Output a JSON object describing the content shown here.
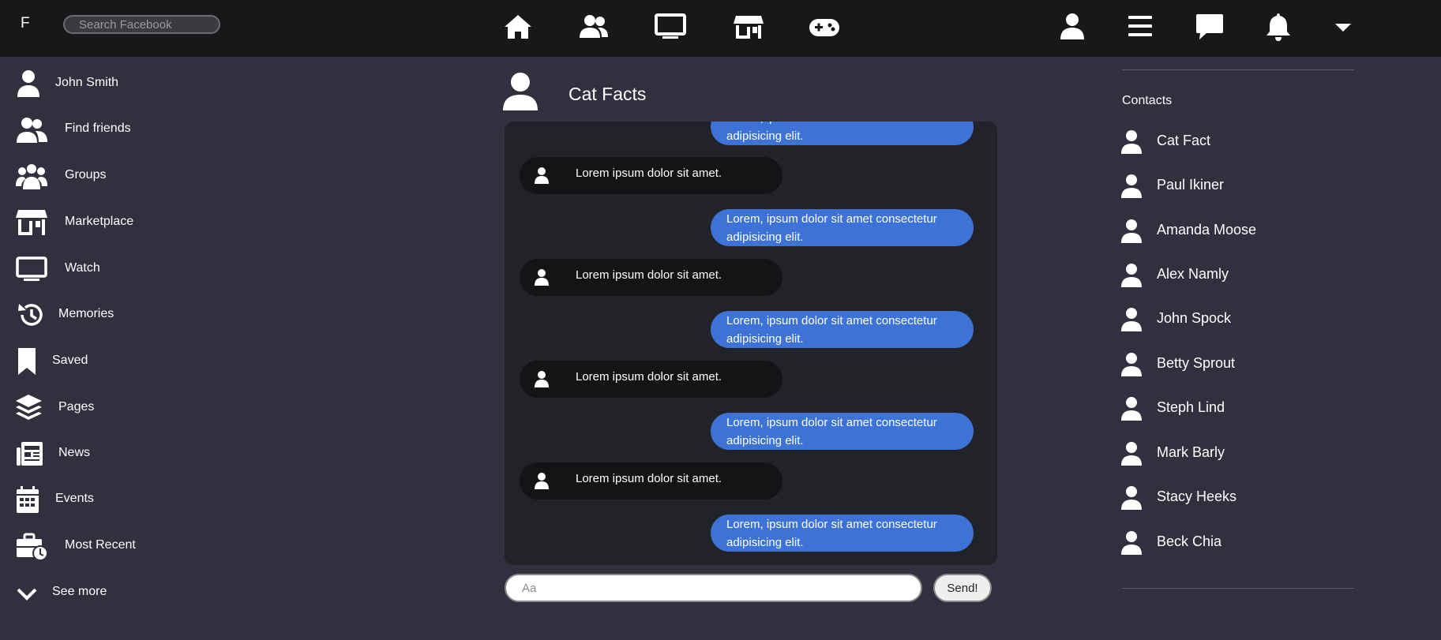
{
  "topbar": {
    "logo": "F",
    "search_placeholder": "Search Facebook",
    "nav_icons": [
      "home-icon",
      "friends-icon",
      "watch-icon",
      "marketplace-icon",
      "gaming-icon"
    ],
    "right_icons": [
      "profile-icon",
      "menu-icon",
      "messenger-icon",
      "bell-icon",
      "caret-down-icon"
    ]
  },
  "sidebar": {
    "items": [
      {
        "label": "John Smith",
        "icon": "user-icon"
      },
      {
        "label": "Find friends",
        "icon": "friends-icon"
      },
      {
        "label": "Groups",
        "icon": "groups-icon"
      },
      {
        "label": "Marketplace",
        "icon": "marketplace-icon"
      },
      {
        "label": "Watch",
        "icon": "watch-icon"
      },
      {
        "label": "Memories",
        "icon": "history-icon"
      },
      {
        "label": "Saved",
        "icon": "bookmark-icon"
      },
      {
        "label": "Pages",
        "icon": "layers-icon"
      },
      {
        "label": "News",
        "icon": "newspaper-icon"
      },
      {
        "label": "Events",
        "icon": "calendar-icon"
      },
      {
        "label": "Most Recent",
        "icon": "briefcase-clock-icon"
      },
      {
        "label": "See more",
        "icon": "chevron-down-icon"
      }
    ]
  },
  "chat": {
    "title": "Cat Facts",
    "messages": [
      {
        "type": "out",
        "text": "Lorem, ipsum dolor sit amet consectetur adipisicing elit."
      },
      {
        "type": "in",
        "text": "Lorem ipsum dolor sit amet."
      },
      {
        "type": "out",
        "text": "Lorem, ipsum dolor sit amet consectetur adipisicing elit."
      },
      {
        "type": "in",
        "text": "Lorem ipsum dolor sit amet."
      },
      {
        "type": "out",
        "text": "Lorem, ipsum dolor sit amet consectetur adipisicing elit."
      },
      {
        "type": "in",
        "text": "Lorem ipsum dolor sit amet."
      },
      {
        "type": "out",
        "text": "Lorem, ipsum dolor sit amet consectetur adipisicing elit."
      },
      {
        "type": "in",
        "text": "Lorem ipsum dolor sit amet."
      },
      {
        "type": "out",
        "text": "Lorem, ipsum dolor sit amet consectetur adipisicing elit."
      }
    ],
    "input_placeholder": "Aa",
    "send_label": "Send!"
  },
  "contacts": {
    "title": "Contacts",
    "items": [
      "Cat Fact",
      "Paul Ikiner",
      "Amanda Moose",
      "Alex Namly",
      "John Spock",
      "Betty Sprout",
      "Steph Lind",
      "Mark Barly",
      "Stacy Heeks",
      "Beck Chia"
    ]
  },
  "colors": {
    "background": "#30303e",
    "topbar": "#18181b",
    "chat_panel": "#222229",
    "incoming_bubble": "#141416",
    "outgoing_bubble": "#3d72d6"
  }
}
